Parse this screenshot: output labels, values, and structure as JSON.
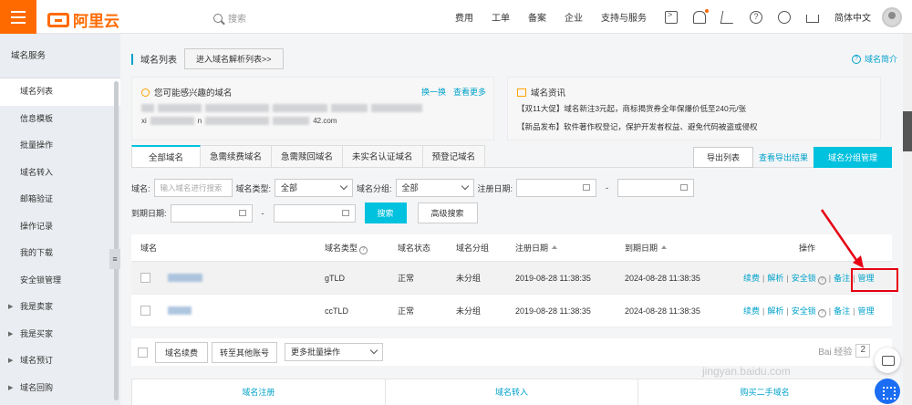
{
  "topbar": {
    "logo_text": "阿里云",
    "search_placeholder": "搜索",
    "nav": [
      "费用",
      "工单",
      "备案",
      "企业",
      "支持与服务"
    ],
    "language": "简体中文",
    "icons": [
      "terminal-icon",
      "bell-icon",
      "cart-icon",
      "help-icon",
      "globe-icon",
      "home-icon"
    ],
    "accent_color": "#ff6a00"
  },
  "sidebar": {
    "header": "域名服务",
    "items": [
      {
        "label": "域名列表",
        "active": true
      },
      {
        "label": "信息模板"
      },
      {
        "label": "批量操作"
      },
      {
        "label": "域名转入"
      },
      {
        "label": "邮箱验证"
      },
      {
        "label": "操作记录"
      },
      {
        "label": "我的下载"
      },
      {
        "label": "安全锁管理"
      }
    ],
    "groups": [
      "我是卖家",
      "我是买家",
      "域名预订",
      "域名回购"
    ],
    "collapse_glyph": "≡"
  },
  "page": {
    "title": "域名列表",
    "dns_button": "进入域名解析列表>>",
    "intro_link": "域名简介",
    "intro_icon_glyph": "?"
  },
  "interest_card": {
    "title": "您可能感兴趣的域名",
    "refresh": "换一换",
    "more": "查看更多",
    "visible_fragments": [
      "xi",
      "n",
      "42.com"
    ]
  },
  "news_card": {
    "title": "域名资讯",
    "lines": [
      "【双11大促】域名新注3元起，商标揭货券全年保爆价低至240元/张",
      "【新品发布】软件著作权登记，保护开发者权益、避免代码被盗或侵权"
    ]
  },
  "tabs": {
    "items": [
      "全部域名",
      "急需续费域名",
      "急需赎回域名",
      "未实名认证域名",
      "预登记域名"
    ],
    "active_index": 0
  },
  "toolbar": {
    "export": "导出列表",
    "export_results": "查看导出结果",
    "group_manage": "域名分组管理",
    "brand_blue": "#00c1de"
  },
  "filters": {
    "domain_label": "域名:",
    "domain_placeholder": "输入域名进行搜索",
    "type_label": "域名类型:",
    "type_value": "全部",
    "group_label": "域名分组:",
    "group_value": "全部",
    "reg_date_label": "注册日期:",
    "exp_date_label": "到期日期:",
    "dash": "-",
    "search_button": "搜索",
    "advanced_button": "高级搜索"
  },
  "table": {
    "headers": {
      "name": "域名",
      "type": "域名类型",
      "status": "域名状态",
      "group": "域名分组",
      "reg": "注册日期",
      "exp": "到期日期",
      "ops": "操作"
    },
    "rows": [
      {
        "type": "gTLD",
        "status": "正常",
        "group": "未分组",
        "reg": "2019-08-28 11:38:35",
        "exp": "2024-08-28 11:38:35",
        "ops": [
          "续费",
          "解析",
          "安全锁",
          "备注",
          "管理"
        ]
      },
      {
        "type": "ccTLD",
        "status": "正常",
        "group": "未分组",
        "reg": "2019-08-28 11:38:35",
        "exp": "2024-08-28 11:38:35",
        "ops": [
          "续费",
          "解析",
          "安全锁",
          "备注",
          "管理"
        ]
      }
    ],
    "separator": "|"
  },
  "batch": {
    "renew": "域名续费",
    "transfer": "转至其他账号",
    "more": "更多批量操作"
  },
  "pager": {
    "page": "2",
    "visible_text": "Bai 经验"
  },
  "bottom_actions": [
    "域名注册",
    "域名转入",
    "购买二手域名"
  ],
  "watermark": "jingyan.baidu.com",
  "annotation_color": "#e60012"
}
